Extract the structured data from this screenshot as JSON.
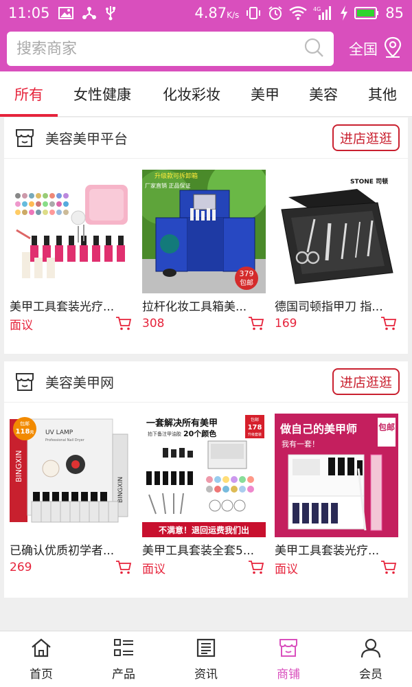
{
  "status_bar": {
    "time": "11:05",
    "speed": "4.87",
    "speed_unit": "K/s",
    "network": "4G",
    "battery": "85",
    "colors": {
      "bar": "#d94fbd",
      "battery_fill": "#2fd42f"
    }
  },
  "search": {
    "placeholder": "搜索商家",
    "region_label": "全国"
  },
  "categories": [
    {
      "label": "所有",
      "active": true
    },
    {
      "label": "女性健康",
      "active": false
    },
    {
      "label": "化妆彩妆",
      "active": false
    },
    {
      "label": "美甲",
      "active": false
    },
    {
      "label": "美容",
      "active": false
    },
    {
      "label": "其他",
      "active": false
    }
  ],
  "shops": [
    {
      "name": "美容美甲平台",
      "visit_label": "进店逛逛",
      "products": [
        {
          "name": "美甲工具套装光疗...",
          "price": "面议",
          "image": "nail-kit-lamp-polish"
        },
        {
          "name": "拉杆化妆工具箱美...",
          "price": "308",
          "image": "blue-trolley-makeup-case",
          "image_text": {
            "top": "升级款可拆卸箱",
            "sub": "厂家直销 正品保证",
            "badge_price": "379",
            "badge_label": "包邮"
          }
        },
        {
          "name": "德国司顿指甲刀 指...",
          "price": "169",
          "image": "manicure-set-leather-case",
          "image_text": {
            "brand": "STONE 司顿"
          }
        }
      ]
    },
    {
      "name": "美容美甲网",
      "visit_label": "进店逛逛",
      "products": [
        {
          "name": "已确认优质初学者...",
          "price": "269",
          "image": "uv-lamp-gel-kit",
          "image_text": {
            "badge_label": "包邮",
            "badge_price": "118",
            "badge_unit": "元",
            "lamp_title": "UV LAMP",
            "lamp_sub": "Professional Nail Dryer",
            "box_brand": "BINGXIN",
            "side_brand": "BINGXIN"
          }
        },
        {
          "name": "美甲工具套装全套5...",
          "price": "面议",
          "image": "complete-nail-set",
          "image_text": {
            "headline": "一套解决所有美甲",
            "sub_left": "拍下备注甲油胶",
            "sub_highlight": "20个颜色",
            "badge_top": "包邮",
            "badge_price": "178",
            "badge_note": "升级套装",
            "footer": "不满意！退回运费我们出"
          }
        },
        {
          "name": "美甲工具套装光疗...",
          "price": "面议",
          "image": "diy-manicure-kit",
          "image_text": {
            "headline": "做自己的美甲师",
            "sub": "我有一套！",
            "badge": "包邮"
          }
        }
      ]
    }
  ],
  "tabbar": [
    {
      "label": "首页",
      "icon": "home-icon",
      "active": false
    },
    {
      "label": "产品",
      "icon": "list-grid-icon",
      "active": false
    },
    {
      "label": "资讯",
      "icon": "news-icon",
      "active": false
    },
    {
      "label": "商铺",
      "icon": "shop-icon",
      "active": true
    },
    {
      "label": "会员",
      "icon": "user-icon",
      "active": false
    }
  ]
}
